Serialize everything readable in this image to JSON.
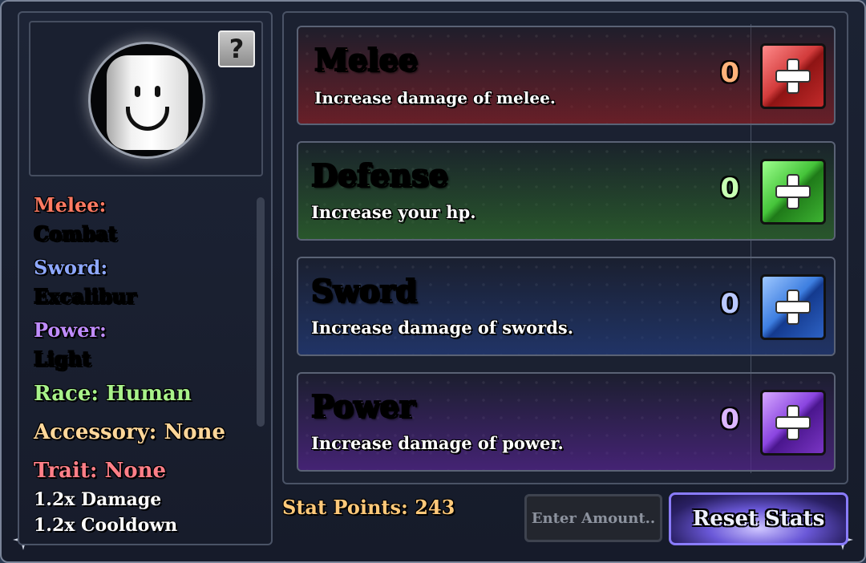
{
  "profile": {
    "help_label": "?"
  },
  "equipment": {
    "melee_label": "Melee:",
    "melee_value": "Combat",
    "sword_label": "Sword:",
    "sword_value": "Excalibur",
    "power_label": "Power:",
    "power_value": "Light",
    "race_text": "Race: Human",
    "accessory_text": "Accessory: None",
    "trait_text": "Trait: None",
    "damage_mult": "1.2x Damage",
    "cooldown_mult": "1.2x Cooldown"
  },
  "stats": [
    {
      "name": "Melee",
      "description": "Increase damage of melee.",
      "value": "0",
      "color": "#ff7f5f"
    },
    {
      "name": "Defense",
      "description": "Increase your hp.",
      "value": "0",
      "color": "#9ff28a"
    },
    {
      "name": "Sword",
      "description": "Increase damage of swords.",
      "value": "0",
      "color": "#8ea8ff"
    },
    {
      "name": "Power",
      "description": "Increase damage of power.",
      "value": "0",
      "color": "#c08dff"
    }
  ],
  "footer": {
    "stat_points": "Stat Points: 243",
    "amount_placeholder": "Enter Amount..",
    "reset_label": "Reset Stats"
  }
}
